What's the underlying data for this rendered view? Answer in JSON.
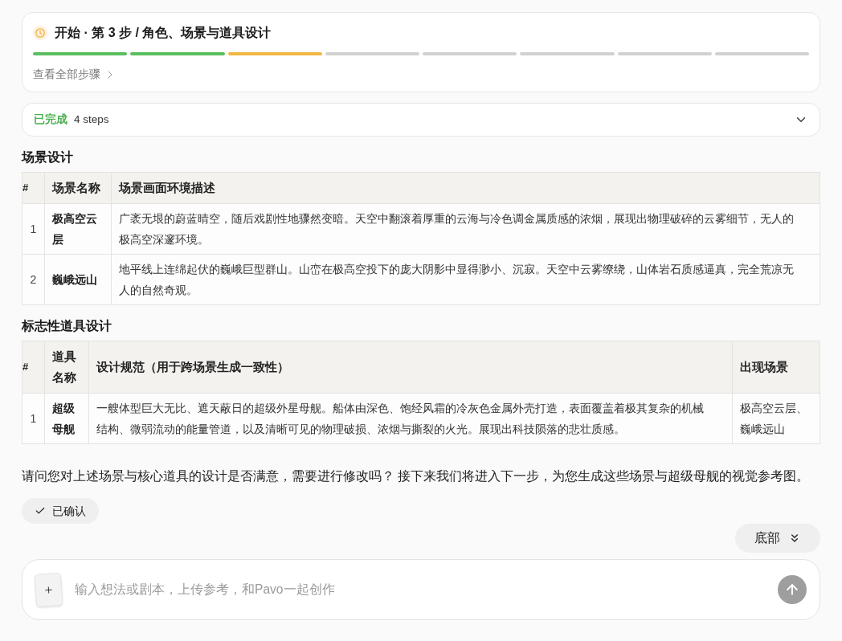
{
  "progress": {
    "title": "开始 · 第 3 步 / 角色、场景与道具设计",
    "steps": [
      {
        "done": true,
        "current": false
      },
      {
        "done": true,
        "current": false
      },
      {
        "done": false,
        "current": true
      },
      {
        "done": false,
        "current": false
      },
      {
        "done": false,
        "current": false
      },
      {
        "done": false,
        "current": false
      },
      {
        "done": false,
        "current": false
      },
      {
        "done": false,
        "current": false
      }
    ],
    "link": "查看全部步骤"
  },
  "completed": {
    "label": "已完成",
    "count": "4 steps",
    "expanded": false
  },
  "sections": [
    {
      "heading": "场景设计",
      "table": {
        "columns": [
          "#",
          "场景名称",
          "场景画面环境描述"
        ],
        "rows": [
          [
            "1",
            "极高空云层",
            "广袤无垠的蔚蓝晴空，随后戏剧性地骤然变暗。天空中翻滚着厚重的云海与冷色调金属质感的浓烟，展现出物理破碎的云雾细节，无人的极高空深邃环境。"
          ],
          [
            "2",
            "巍峨远山",
            "地平线上连绵起伏的巍峨巨型群山。山峦在极高空投下的庞大阴影中显得渺小、沉寂。天空中云雾缭绕，山体岩石质感逼真，完全荒凉无人的自然奇观。"
          ]
        ]
      }
    },
    {
      "heading": "标志性道具设计",
      "table": {
        "columns": [
          "#",
          "道具名称",
          "设计规范（用于跨场景生成一致性）",
          "出现场景"
        ],
        "rows": [
          [
            "1",
            "超级母舰",
            "一艘体型巨大无比、遮天蔽日的超级外星母舰。船体由深色、饱经风霜的冷灰色金属外壳打造，表面覆盖着极其复杂的机械结构、微弱流动的能量管道，以及清晰可见的物理破损、浓烟与撕裂的火光。展现出科技陨落的悲壮质感。",
            "极高空云层、巍峨远山"
          ]
        ]
      }
    }
  ],
  "message": "请问您对上述场景与核心道具的设计是否满意，需要进行修改吗？ 接下来我们将进入下一步，为您生成这些场景与超级母舰的视觉参考图。",
  "confirm_chip": {
    "label": "已确认"
  },
  "scroll_button": {
    "label": "底部"
  },
  "composer": {
    "placeholder": "输入想法或剧本，上传参考，和Pavo一起创作",
    "send_disabled": true
  }
}
